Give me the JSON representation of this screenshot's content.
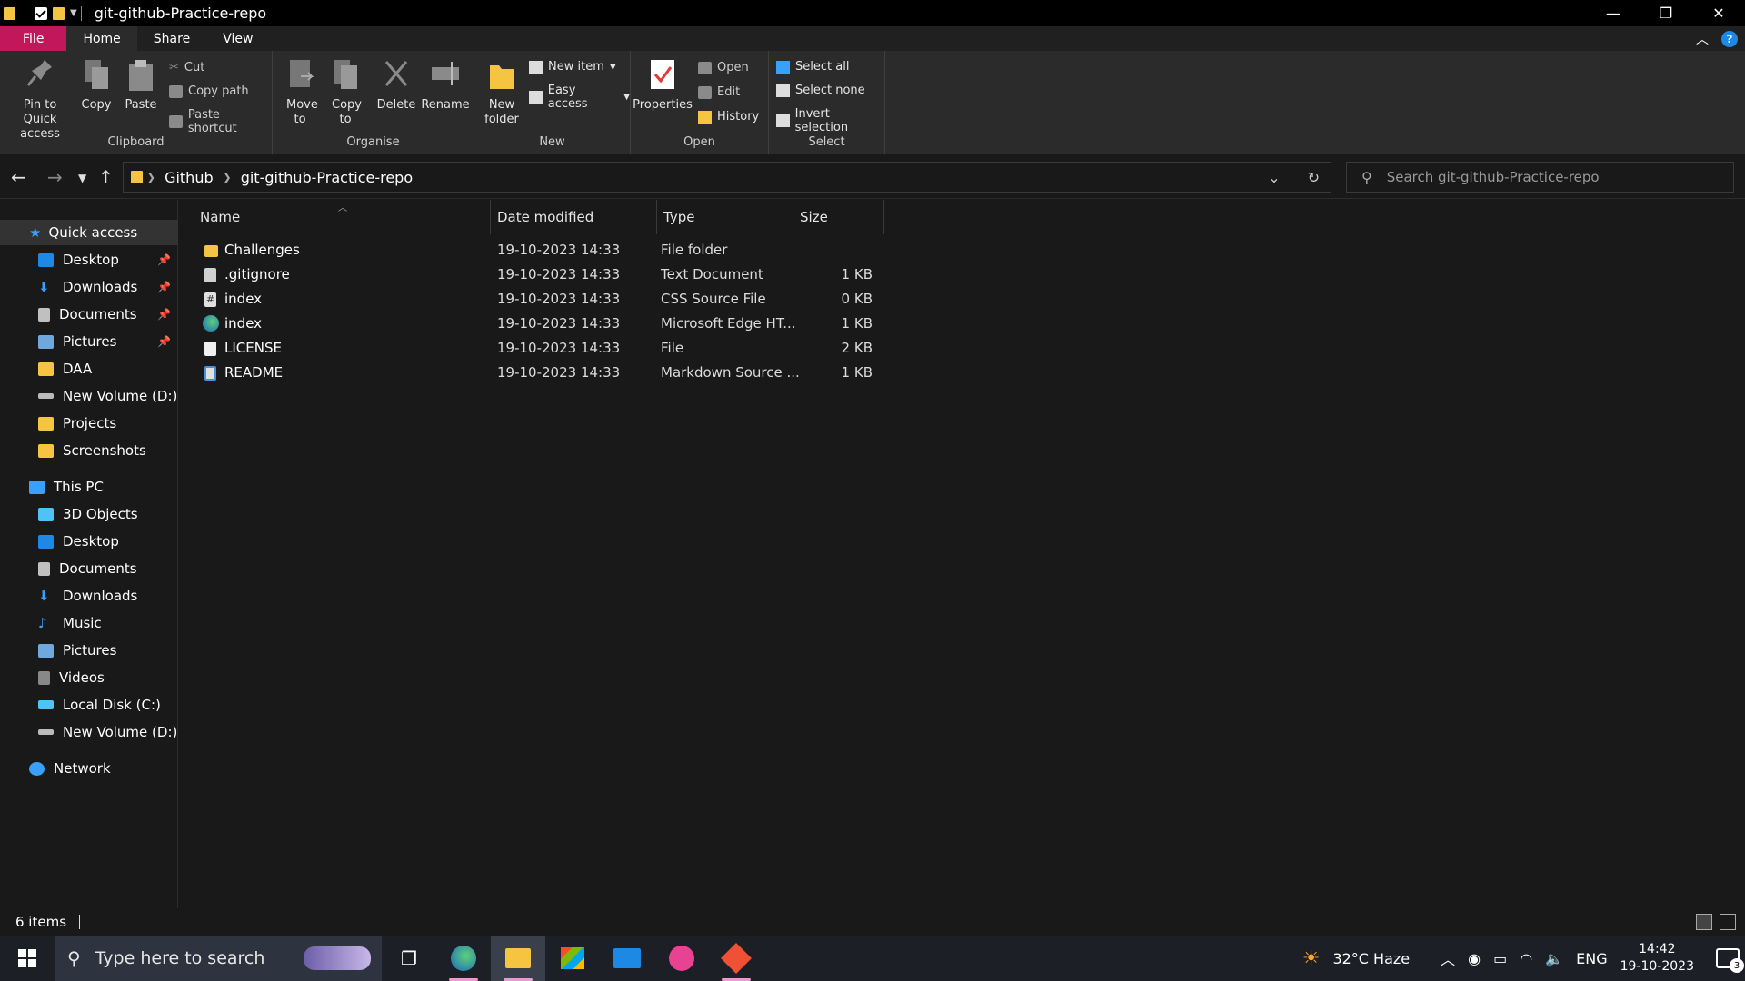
{
  "window": {
    "title": "git-github-Practice-repo"
  },
  "ribbon_tabs": [
    "File",
    "Home",
    "Share",
    "View"
  ],
  "ribbon": {
    "clipboard": {
      "label": "Clipboard",
      "pin": "Pin to Quick access",
      "copy": "Copy",
      "paste": "Paste",
      "cut": "Cut",
      "copy_path": "Copy path",
      "paste_shortcut": "Paste shortcut"
    },
    "organise": {
      "label": "Organise",
      "move_to": "Move to",
      "copy_to": "Copy to",
      "delete": "Delete",
      "rename": "Rename"
    },
    "new": {
      "label": "New",
      "new_folder": "New folder",
      "new_item": "New item",
      "easy_access": "Easy access"
    },
    "open": {
      "label": "Open",
      "properties": "Properties",
      "open": "Open",
      "edit": "Edit",
      "history": "History"
    },
    "select": {
      "label": "Select",
      "select_all": "Select all",
      "select_none": "Select none",
      "invert_selection": "Invert selection"
    }
  },
  "address": {
    "crumbs": [
      "Github",
      "git-github-Practice-repo"
    ],
    "search_placeholder": "Search git-github-Practice-repo"
  },
  "sidebar": {
    "quick_access": "Quick access",
    "quick_items": [
      {
        "label": "Desktop",
        "pinned": true
      },
      {
        "label": "Downloads",
        "pinned": true
      },
      {
        "label": "Documents",
        "pinned": true
      },
      {
        "label": "Pictures",
        "pinned": true
      },
      {
        "label": "DAA",
        "pinned": false
      },
      {
        "label": "New Volume (D:)",
        "pinned": false
      },
      {
        "label": "Projects",
        "pinned": false
      },
      {
        "label": "Screenshots",
        "pinned": false
      }
    ],
    "this_pc": "This PC",
    "pc_items": [
      "3D Objects",
      "Desktop",
      "Documents",
      "Downloads",
      "Music",
      "Pictures",
      "Videos",
      "Local Disk (C:)",
      "New Volume (D:)"
    ],
    "network": "Network"
  },
  "columns": [
    "Name",
    "Date modified",
    "Type",
    "Size"
  ],
  "files": [
    {
      "name": "Challenges",
      "date": "19-10-2023 14:33",
      "type": "File folder",
      "size": "",
      "icon": "folder-icon"
    },
    {
      "name": ".gitignore",
      "date": "19-10-2023 14:33",
      "type": "Text Document",
      "size": "1 KB",
      "icon": "text-file-icon"
    },
    {
      "name": "index",
      "date": "19-10-2023 14:33",
      "type": "CSS Source File",
      "size": "0 KB",
      "icon": "css-file-icon"
    },
    {
      "name": "index",
      "date": "19-10-2023 14:33",
      "type": "Microsoft Edge HT...",
      "size": "1 KB",
      "icon": "edge-html-icon"
    },
    {
      "name": "LICENSE",
      "date": "19-10-2023 14:33",
      "type": "File",
      "size": "2 KB",
      "icon": "file-icon"
    },
    {
      "name": "README",
      "date": "19-10-2023 14:33",
      "type": "Markdown Source ...",
      "size": "1 KB",
      "icon": "markdown-file-icon"
    }
  ],
  "status": {
    "count": "6 items"
  },
  "taskbar": {
    "search_placeholder": "Type here to search",
    "weather": "32°C  Haze",
    "language": "ENG",
    "time": "14:42",
    "date": "19-10-2023",
    "notifications": "3"
  },
  "colors": {
    "file_tab": "#c2185b",
    "folder": "#f5c542",
    "accent_blue": "#3aa0ff"
  }
}
